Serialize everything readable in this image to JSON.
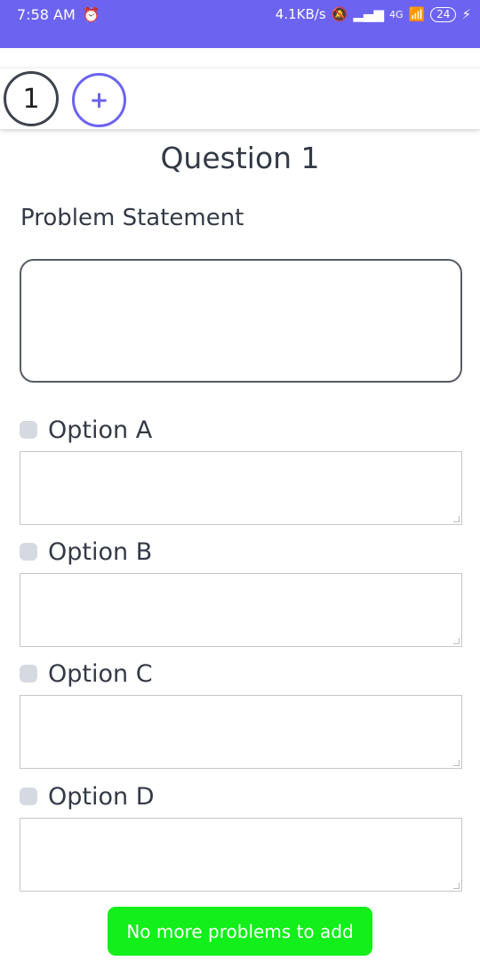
{
  "status": {
    "time": "7:58 AM",
    "speed": "4.1KB/s",
    "network": "4G",
    "battery": "24"
  },
  "toolbar": {
    "question_number": "1",
    "add_label": "+"
  },
  "question": {
    "title": "Question 1",
    "problem_label": "Problem Statement",
    "problem_value": ""
  },
  "options": [
    {
      "label": "Option A",
      "checked": false,
      "value": ""
    },
    {
      "label": "Option B",
      "checked": false,
      "value": ""
    },
    {
      "label": "Option C",
      "checked": false,
      "value": ""
    },
    {
      "label": "Option D",
      "checked": false,
      "value": ""
    }
  ],
  "footer": {
    "button_label": "No more problems to add"
  },
  "colors": {
    "accent": "#6c63f0",
    "button": "#12ef1a",
    "text": "#333a47"
  }
}
